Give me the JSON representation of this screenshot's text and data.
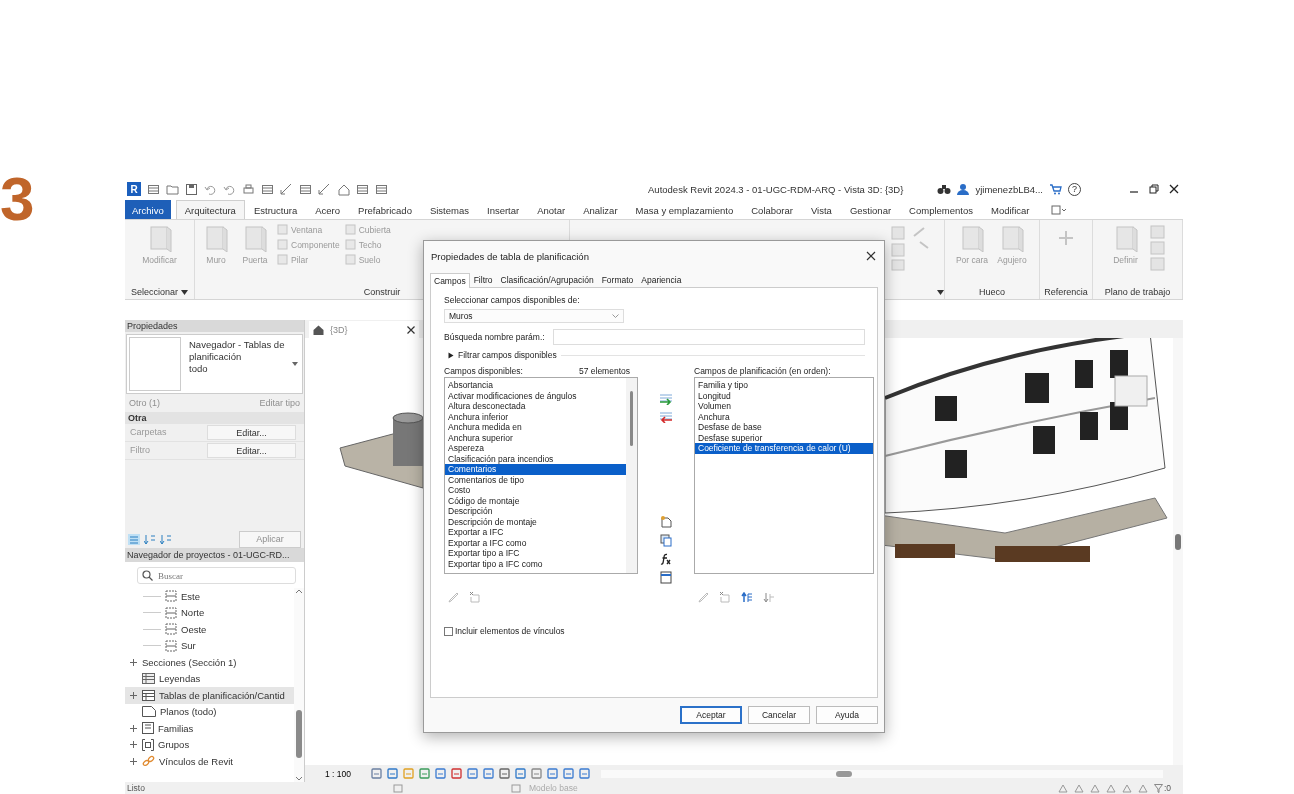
{
  "step_number": "3",
  "window": {
    "logo": "R",
    "title": "Autodesk Revit 2024.3 - 01-UGC-RDM-ARQ - Vista 3D: {3D}",
    "user": "yjimenezbLB4...",
    "help": "?"
  },
  "ribbon_tabs": [
    {
      "label": "Archivo",
      "kind": "file",
      "selected": false
    },
    {
      "label": "Arquitectura",
      "kind": "tab",
      "selected": true
    },
    {
      "label": "Estructura",
      "kind": "tab",
      "selected": false
    },
    {
      "label": "Acero",
      "kind": "tab",
      "selected": false
    },
    {
      "label": "Prefabricado",
      "kind": "tab",
      "selected": false
    },
    {
      "label": "Sistemas",
      "kind": "tab",
      "selected": false
    },
    {
      "label": "Insertar",
      "kind": "tab",
      "selected": false
    },
    {
      "label": "Anotar",
      "kind": "tab",
      "selected": false
    },
    {
      "label": "Analizar",
      "kind": "tab",
      "selected": false
    },
    {
      "label": "Masa y emplazamiento",
      "kind": "tab",
      "selected": false
    },
    {
      "label": "Colaborar",
      "kind": "tab",
      "selected": false
    },
    {
      "label": "Vista",
      "kind": "tab",
      "selected": false
    },
    {
      "label": "Gestionar",
      "kind": "tab",
      "selected": false
    },
    {
      "label": "Complementos",
      "kind": "tab",
      "selected": false
    },
    {
      "label": "Modificar",
      "kind": "tab",
      "selected": false
    }
  ],
  "ribbon_panels": [
    {
      "label": "Seleccionar",
      "buttons": [
        {
          "label": "Modificar",
          "kind": "large",
          "disabled": true
        }
      ]
    },
    {
      "label": "Construir",
      "buttons": [
        {
          "label": "Muro",
          "kind": "large",
          "disabled": true
        },
        {
          "label": "Puerta",
          "kind": "large",
          "disabled": true
        },
        {
          "label": "Ventana",
          "kind": "small",
          "disabled": true
        },
        {
          "label": "Componente",
          "kind": "small",
          "disabled": true
        },
        {
          "label": "Pilar",
          "kind": "small",
          "disabled": true
        },
        {
          "label": "Cubierta",
          "kind": "small",
          "disabled": true
        },
        {
          "label": "Techo",
          "kind": "small",
          "disabled": true
        },
        {
          "label": "Suelo",
          "kind": "small",
          "disabled": true
        }
      ]
    },
    {
      "caret": true
    },
    {
      "label": "Hueco",
      "buttons": [
        {
          "label": "Por cara",
          "kind": "large",
          "disabled": true
        },
        {
          "label": "Agujero",
          "kind": "large",
          "disabled": true
        }
      ]
    },
    {
      "label": "Referencia"
    },
    {
      "label": "Plano de trabajo",
      "buttons": [
        {
          "label": "Definir",
          "kind": "large",
          "disabled": true
        }
      ]
    }
  ],
  "properties": {
    "title": "Propiedades",
    "type_name": "Navegador - Tablas de planificación",
    "type_sub": "todo",
    "instance_filter": {
      "label": "Otro (1)",
      "disabled": true
    },
    "edit_type": {
      "label": "Editar tipo",
      "disabled": true
    },
    "group": "Otra",
    "rows": [
      {
        "name": "Carpetas",
        "value": "Editar..."
      },
      {
        "name": "Filtro",
        "value": "Editar..."
      }
    ],
    "apply": {
      "label": "Aplicar",
      "disabled": true
    }
  },
  "project_browser": {
    "title": "Navegador de proyectos - 01-UGC-RD...",
    "search": {
      "placeholder": "Buscar"
    },
    "tree_continued": [
      {
        "label": "Este",
        "kind": "elevation",
        "selected": false
      },
      {
        "label": "Norte",
        "kind": "elevation",
        "selected": false
      },
      {
        "label": "Oeste",
        "kind": "elevation",
        "selected": false
      },
      {
        "label": "Sur",
        "kind": "elevation",
        "selected": false
      }
    ],
    "tree": [
      {
        "label": "Secciones (Sección 1)",
        "kind": "none",
        "expandable": true,
        "selected": false
      },
      {
        "label": "Leyendas",
        "kind": "legend",
        "expandable": false,
        "selected": false
      },
      {
        "label": "Tablas de planificación/Cantid",
        "kind": "schedule",
        "expandable": true,
        "selected": true
      },
      {
        "label": "Planos (todo)",
        "kind": "sheet",
        "expandable": false,
        "selected": false
      },
      {
        "label": "Familias",
        "kind": "family",
        "expandable": true,
        "selected": false
      },
      {
        "label": "Grupos",
        "kind": "group",
        "expandable": true,
        "selected": false
      },
      {
        "label": "Vínculos de Revit",
        "kind": "link",
        "expandable": true,
        "selected": false
      }
    ]
  },
  "view": {
    "tab": "{3D}",
    "scale": "1 : 100"
  },
  "status_bar": {
    "message": "Listo",
    "model": "Modelo base",
    "filter_count": ":0"
  },
  "dialog": {
    "title": "Propiedades de tabla de planificación",
    "tabs": [
      {
        "label": "Campos",
        "selected": true
      },
      {
        "label": "Filtro",
        "selected": false
      },
      {
        "label": "Clasificación/Agrupación",
        "selected": false
      },
      {
        "label": "Formato",
        "selected": false
      },
      {
        "label": "Apariencia",
        "selected": false
      }
    ],
    "source_label": "Seleccionar campos disponibles de:",
    "source_value": "Muros",
    "search_label": "Búsqueda nombre parám.:",
    "filter_toggle": {
      "label": "Filtrar campos disponibles",
      "expanded": false
    },
    "available_label": "Campos disponibles:",
    "available_count": "57 elementos",
    "available": [
      {
        "label": "Absortancia",
        "selected": false
      },
      {
        "label": "Activar modificaciones de ángulos",
        "selected": false
      },
      {
        "label": "Altura desconectada",
        "selected": false
      },
      {
        "label": "Anchura inferior",
        "selected": false
      },
      {
        "label": "Anchura medida en",
        "selected": false
      },
      {
        "label": "Anchura superior",
        "selected": false
      },
      {
        "label": "Aspereza",
        "selected": false
      },
      {
        "label": "Clasificación para incendios",
        "selected": false
      },
      {
        "label": "Comentarios",
        "selected": true
      },
      {
        "label": "Comentarios de tipo",
        "selected": false
      },
      {
        "label": "Costo",
        "selected": false
      },
      {
        "label": "Código de montaje",
        "selected": false
      },
      {
        "label": "Descripción",
        "selected": false
      },
      {
        "label": "Descripción de montaje",
        "selected": false
      },
      {
        "label": "Exportar a IFC",
        "selected": false
      },
      {
        "label": "Exportar a IFC como",
        "selected": false
      },
      {
        "label": "Exportar tipo a IFC",
        "selected": false
      },
      {
        "label": "Exportar tipo a IFC como",
        "selected": false
      }
    ],
    "scheduled_label": "Campos de planificación (en orden):",
    "scheduled": [
      {
        "label": "Familia y tipo",
        "selected": false
      },
      {
        "label": "Longitud",
        "selected": false
      },
      {
        "label": "Volumen",
        "selected": false
      },
      {
        "label": "Anchura",
        "selected": false
      },
      {
        "label": "Desfase de base",
        "selected": false
      },
      {
        "label": "Desfase superior",
        "selected": false
      },
      {
        "label": "Coeficiente de transferencia de calor (U)",
        "selected": true
      }
    ],
    "include_links": {
      "label": "Incluir elementos de vínculos",
      "checked": false
    },
    "buttons": [
      {
        "label": "Aceptar",
        "kind": "default"
      },
      {
        "label": "Cancelar",
        "kind": "normal"
      },
      {
        "label": "Ayuda",
        "kind": "normal"
      }
    ]
  }
}
